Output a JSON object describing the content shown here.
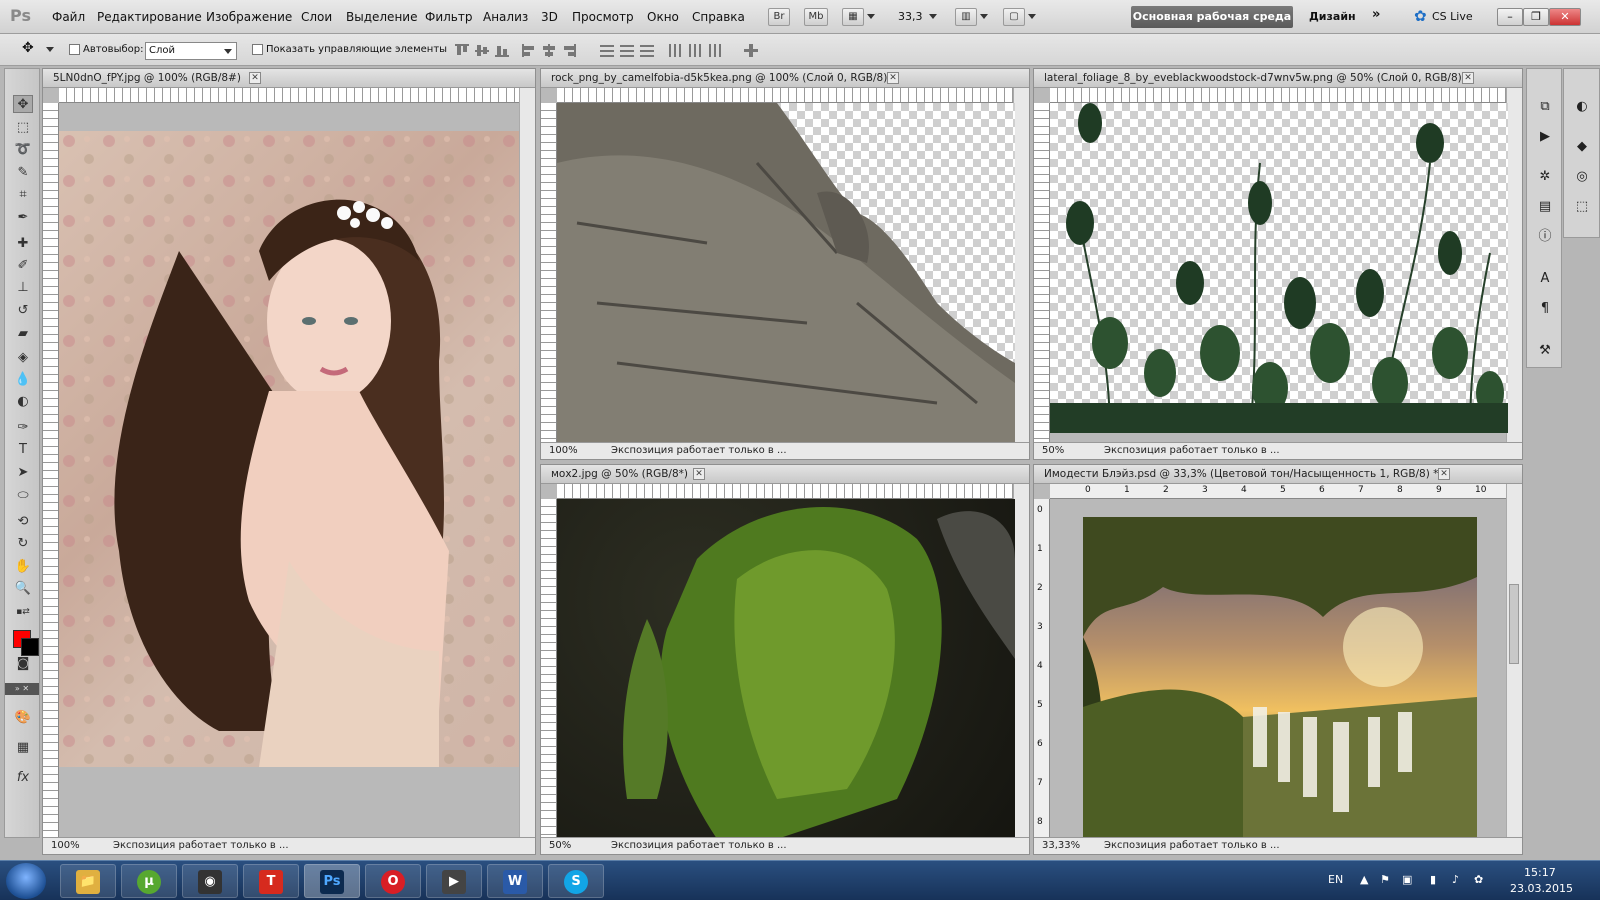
{
  "app": {
    "logo": "Ps"
  },
  "menu": [
    "Файл",
    "Редактирование",
    "Изображение",
    "Слои",
    "Выделение",
    "Фильтр",
    "Анализ",
    "3D",
    "Просмотр",
    "Окно",
    "Справка"
  ],
  "menubar": {
    "bridge_button": "Br",
    "minibridge_button": "Mb",
    "zoom_value": "33,3",
    "workspace_active": "Основная рабочая среда",
    "workspace_design": "Дизайн",
    "more_workspaces": "»",
    "cs_live": "CS Live"
  },
  "options_bar": {
    "autoselect_label": "Автовыбор:",
    "autoselect_value": "Слой",
    "show_controls_label": "Показать управляющие элементы"
  },
  "documents": [
    {
      "title": "5LN0dnO_fPY.jpg @ 100% (RGB/8#)",
      "zoom": "100%",
      "status": "Экспозиция работает только в ..."
    },
    {
      "title": "rock_png_by_camelfobia-d5k5kea.png @ 100% (Слой 0, RGB/8)",
      "zoom": "100%",
      "status": "Экспозиция работает только в ..."
    },
    {
      "title": "lateral_foliage_8_by_eveblackwoodstock-d7wnv5w.png @ 50% (Слой 0, RGB/8)",
      "zoom": "50%",
      "status": "Экспозиция работает только в ..."
    },
    {
      "title": "мох2.jpg @ 50% (RGB/8*)",
      "zoom": "50%",
      "status": "Экспозиция работает только в ..."
    },
    {
      "title": "Имодести Блэйз.psd @ 33,3% (Цветовой тон/Насыщенность 1, RGB/8) *",
      "zoom": "33,33%",
      "status": "Экспозиция работает только в ..."
    }
  ],
  "ruler_marks": {
    "h": [
      "0",
      "1",
      "2",
      "3",
      "4",
      "5",
      "6",
      "7",
      "8",
      "9",
      "10"
    ],
    "v": [
      "0",
      "1",
      "2",
      "3",
      "4",
      "5",
      "6",
      "7",
      "8"
    ]
  },
  "taskbar": {
    "apps": [
      {
        "name": "Проводник",
        "glyph": "📁"
      },
      {
        "name": "uTorrent",
        "glyph": "µ"
      },
      {
        "name": "Камера",
        "glyph": "◉"
      },
      {
        "name": "T",
        "glyph": "T"
      },
      {
        "name": "Photoshop",
        "glyph": "Ps"
      },
      {
        "name": "Opera",
        "glyph": "O"
      },
      {
        "name": "Media Player",
        "glyph": "▶"
      },
      {
        "name": "Word",
        "glyph": "W"
      },
      {
        "name": "Skype",
        "glyph": "S"
      }
    ],
    "language": "EN",
    "time": "15:17",
    "date": "23.03.2015"
  },
  "colors": {
    "foreground": "#ff0000",
    "background": "#000000",
    "taskbar": "#1f3d6b"
  }
}
